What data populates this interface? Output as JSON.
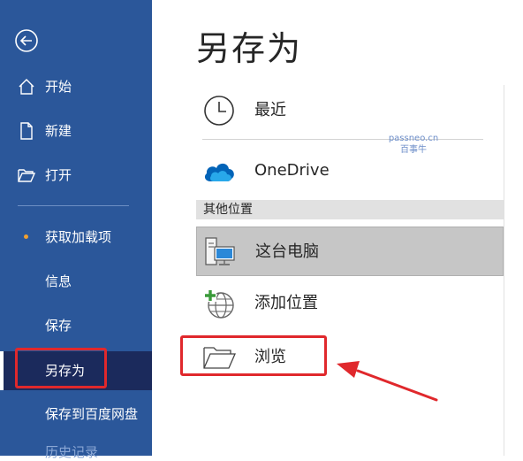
{
  "sidebar": {
    "items": [
      {
        "label": "开始"
      },
      {
        "label": "新建"
      },
      {
        "label": "打开"
      },
      {
        "label": "获取加载项"
      },
      {
        "label": "信息"
      },
      {
        "label": "保存"
      },
      {
        "label": "另存为"
      },
      {
        "label": "保存到百度网盘"
      }
    ],
    "faded_label": "历史记录",
    "selected": "另存为",
    "background_color": "#2b579a",
    "selected_color": "#1b2a5c"
  },
  "main": {
    "title": "另存为",
    "recent_label": "最近",
    "onedrive_label": "OneDrive",
    "other_locations_header": "其他位置",
    "this_pc_label": "这台电脑",
    "add_location_label": "添加位置",
    "browse_label": "浏览"
  },
  "watermark": {
    "line1": "passneo.cn",
    "line2": "百事牛"
  },
  "annotation_color": "#e0282c"
}
